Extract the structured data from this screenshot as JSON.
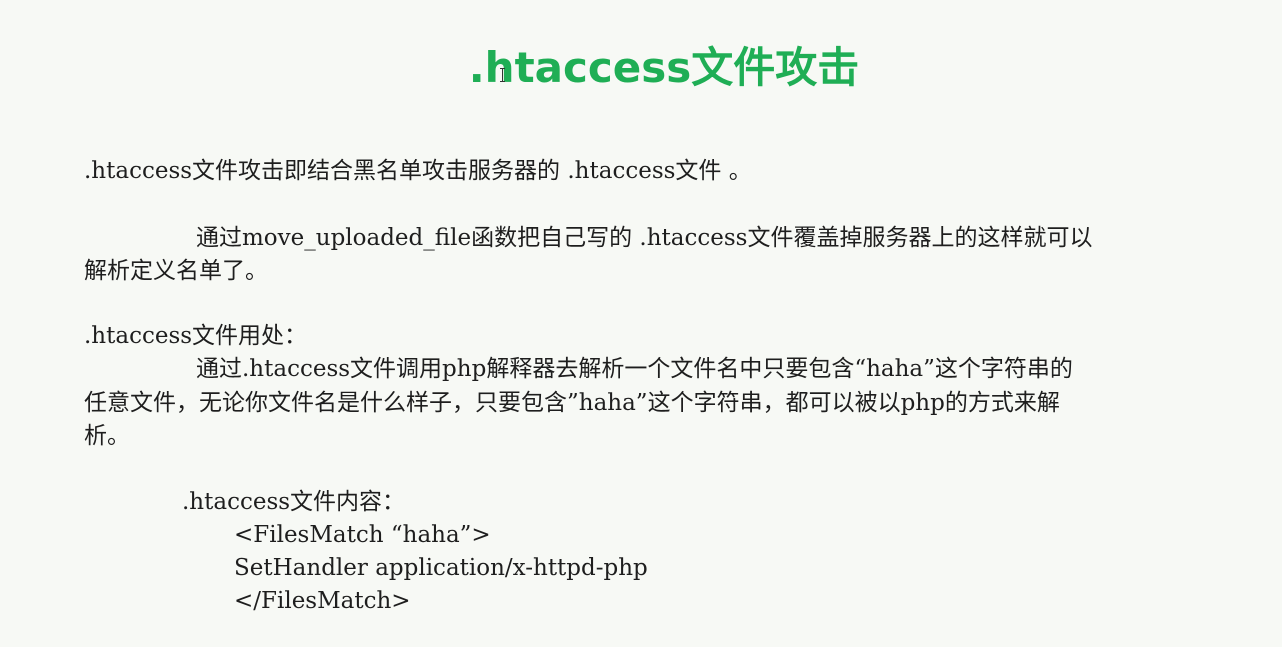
{
  "slide": {
    "title": ".htaccess文件攻击",
    "intro": ".htaccess文件攻击即结合黑名单攻击服务器的 .htaccess文件 。",
    "para1_line1": "通过move_uploaded_file函数把自己写的 .htaccess文件覆盖掉服务器上的这样就可以",
    "para1_line2": "解析定义名单了。",
    "usage_heading": ".htaccess文件用处：",
    "para2_line1": "通过.htaccess文件调用php解释器去解析一个文件名中只要包含“haha”这个字符串的",
    "para2_line2": "任意文件，无论你文件名是什么样子，只要包含”haha”这个字符串，都可以被以php的方式来解",
    "para2_line3": "析。",
    "content_heading": ".htaccess文件内容：",
    "code": [
      "<FilesMatch “haha”>",
      "SetHandler application/x-httpd-php",
      "</FilesMatch>"
    ],
    "title_color": "#1fae55"
  }
}
